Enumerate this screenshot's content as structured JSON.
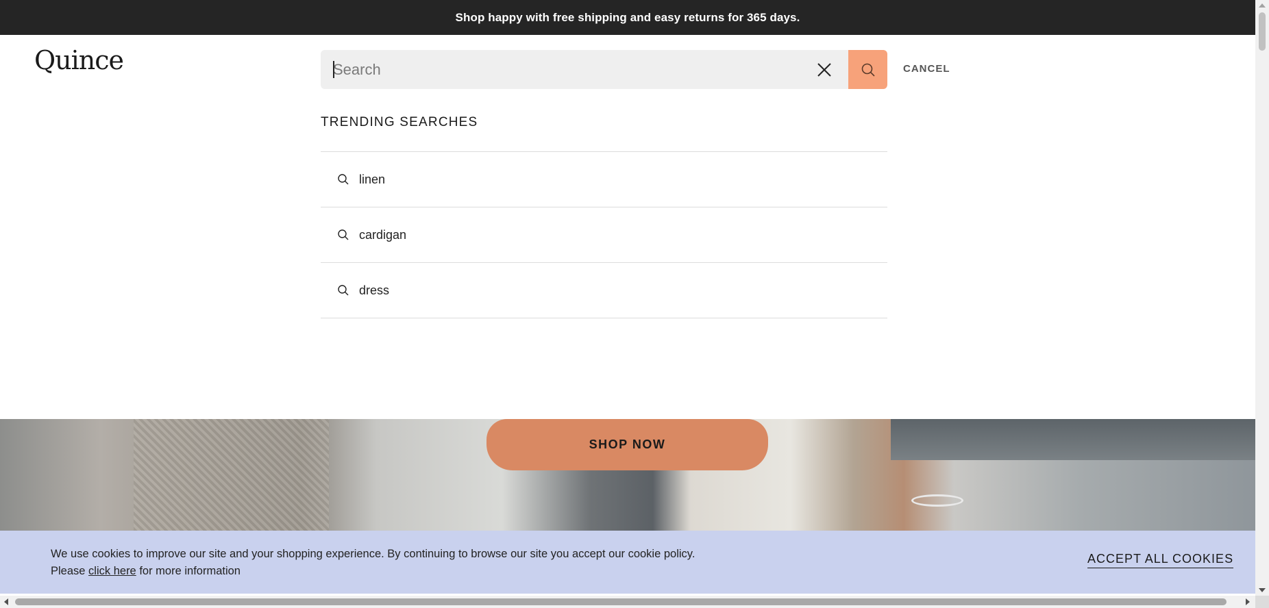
{
  "promo": {
    "text": "Shop happy with free shipping and easy returns for 365 days."
  },
  "header": {
    "logo": "Quince"
  },
  "search": {
    "placeholder": "Search",
    "value": "",
    "cancel_label": "CANCEL"
  },
  "trending": {
    "title": "TRENDING SEARCHES",
    "items": [
      {
        "label": "linen",
        "icon": "search-icon"
      },
      {
        "label": "cardigan",
        "icon": "search-icon"
      },
      {
        "label": "dress",
        "icon": "search-icon"
      }
    ]
  },
  "hero": {
    "cta_label": "SHOP NOW"
  },
  "cookie": {
    "line1": "We use cookies to improve our site and your shopping experience. By continuing to browse our site you accept our cookie policy.",
    "line2_prefix": "Please ",
    "link_label": "click here",
    "line2_suffix": " for more information",
    "accept_label": "ACCEPT ALL COOKIES"
  },
  "colors": {
    "promo_bg": "#252525",
    "search_button": "#f7a27a",
    "shop_now_button": "#d98963",
    "cookie_bg": "#c9d1ee"
  }
}
